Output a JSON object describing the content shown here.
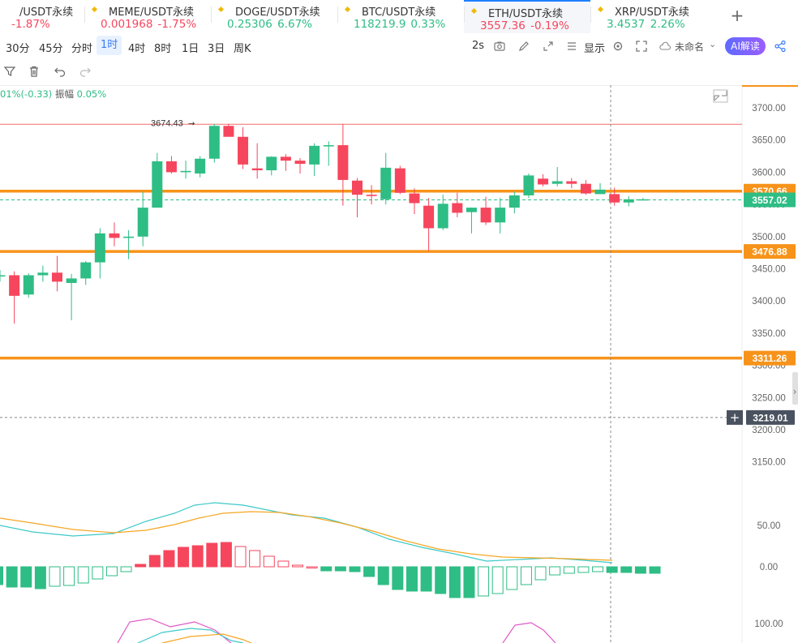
{
  "tabs": [
    {
      "name": "/USDT永续",
      "price": "",
      "change": "-1.87%",
      "dir": "down",
      "active": false
    },
    {
      "name": "MEME/USDT永续",
      "price": "0.001968",
      "change": "-1.75%",
      "dir": "down",
      "active": false
    },
    {
      "name": "DOGE/USDT永续",
      "price": "0.25306",
      "change": "6.67%",
      "dir": "up",
      "active": false
    },
    {
      "name": "BTC/USDT永续",
      "price": "118219.9",
      "change": "0.33%",
      "dir": "up",
      "active": false
    },
    {
      "name": "ETH/USDT永续",
      "price": "3557.36",
      "change": "-0.19%",
      "dir": "down",
      "active": true
    },
    {
      "name": "XRP/USDT永续",
      "price": "3.4537",
      "change": "2.26%",
      "dir": "up",
      "active": false
    }
  ],
  "toolbar": {
    "timeframes": [
      "30分",
      "45分",
      "分时",
      "1时",
      "4时",
      "8时",
      "1日",
      "3日",
      "周K"
    ],
    "selected": "1时",
    "interval_label": "2s",
    "display_label": "显示",
    "template_label": "未命名",
    "ai_label": "AI解读"
  },
  "info": {
    "change_text": "01%(-0.33)",
    "amplitude_label": "振幅",
    "amplitude_value": "0.05%"
  },
  "colors": {
    "up": "#2ebd85",
    "down": "#f6465d",
    "orange": "#f7931a",
    "ma_orange": "#f5a623",
    "ma_cyan": "#3ec9c9",
    "kdj_pink": "#e057c7"
  },
  "chart_data": {
    "type": "candlestick",
    "y_ticks": [
      "3700.00",
      "3650.00",
      "3600.00",
      "3550.00",
      "3500.00",
      "3450.00",
      "3400.00",
      "3350.00",
      "3300.00",
      "3250.00",
      "3200.00",
      "3150.00"
    ],
    "ylim": [
      3130,
      3720
    ],
    "high_marker": "3674.43",
    "price_labels": [
      {
        "value": "3570.66",
        "kind": "orange"
      },
      {
        "value": "3557.02",
        "kind": "green"
      },
      {
        "value": "3476.88",
        "kind": "orange"
      },
      {
        "value": "3311.26",
        "kind": "orange"
      },
      {
        "value": "3219.01",
        "kind": "cursor"
      }
    ],
    "horizontal_levels": [
      3674.43,
      3570.66,
      3476.88,
      3311.26
    ],
    "candles": [
      [
        3440,
        3448,
        3430,
        3440
      ],
      [
        3440,
        3446,
        3365,
        3408
      ],
      [
        3410,
        3443,
        3405,
        3440
      ],
      [
        3440,
        3455,
        3430,
        3444
      ],
      [
        3444,
        3470,
        3415,
        3430
      ],
      [
        3428,
        3442,
        3370,
        3435
      ],
      [
        3435,
        3462,
        3425,
        3460
      ],
      [
        3460,
        3513,
        3435,
        3505
      ],
      [
        3505,
        3522,
        3485,
        3498
      ],
      [
        3498,
        3510,
        3465,
        3500
      ],
      [
        3500,
        3570,
        3485,
        3545
      ],
      [
        3545,
        3630,
        3545,
        3617
      ],
      [
        3617,
        3625,
        3598,
        3600
      ],
      [
        3600,
        3618,
        3590,
        3602
      ],
      [
        3598,
        3625,
        3592,
        3621
      ],
      [
        3621,
        3675,
        3615,
        3672
      ],
      [
        3672,
        3675,
        3658,
        3655
      ],
      [
        3655,
        3670,
        3605,
        3612
      ],
      [
        3606,
        3645,
        3590,
        3603
      ],
      [
        3603,
        3625,
        3595,
        3624
      ],
      [
        3624,
        3628,
        3602,
        3618
      ],
      [
        3618,
        3622,
        3598,
        3613
      ],
      [
        3612,
        3645,
        3594,
        3641
      ],
      [
        3641,
        3648,
        3610,
        3642
      ],
      [
        3642,
        3675,
        3548,
        3588
      ],
      [
        3587,
        3591,
        3530,
        3565
      ],
      [
        3565,
        3580,
        3550,
        3563
      ],
      [
        3558,
        3630,
        3550,
        3607
      ],
      [
        3606,
        3610,
        3566,
        3568
      ],
      [
        3567,
        3575,
        3535,
        3552
      ],
      [
        3548,
        3560,
        3478,
        3513
      ],
      [
        3513,
        3565,
        3510,
        3551
      ],
      [
        3552,
        3568,
        3530,
        3537
      ],
      [
        3538,
        3545,
        3505,
        3545
      ],
      [
        3545,
        3562,
        3518,
        3522
      ],
      [
        3522,
        3560,
        3505,
        3545
      ],
      [
        3545,
        3570,
        3536,
        3564
      ],
      [
        3564,
        3598,
        3560,
        3595
      ],
      [
        3590,
        3597,
        3578,
        3581
      ],
      [
        3582,
        3608,
        3578,
        3586
      ],
      [
        3586,
        3591,
        3575,
        3582
      ],
      [
        3582,
        3588,
        3565,
        3567
      ],
      [
        3566,
        3583,
        3568,
        3573
      ],
      [
        3566,
        3576,
        3548,
        3553
      ],
      [
        3553,
        3563,
        3547,
        3558
      ],
      [
        3557,
        3560,
        3556,
        3558
      ]
    ],
    "indicator_ticks": [
      "50.00",
      "0.00",
      "100.00"
    ],
    "macd_hist": [
      -22,
      -25,
      -25,
      -27,
      -24,
      -23,
      -20,
      -15,
      -11,
      -6,
      3,
      14,
      20,
      24,
      26,
      29,
      30,
      25,
      20,
      13,
      7,
      2,
      0,
      -5,
      -5,
      -6,
      -12,
      -22,
      -28,
      -30,
      -30,
      -33,
      -38,
      -38,
      -36,
      -33,
      -28,
      -22,
      -16,
      -10,
      -8,
      -7,
      -6,
      -7,
      -7,
      -8,
      -8
    ]
  }
}
